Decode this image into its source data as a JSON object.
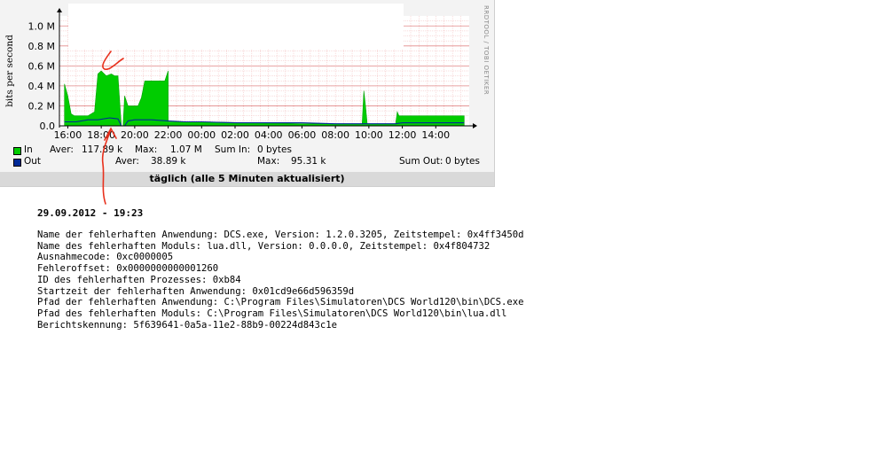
{
  "chart_data": {
    "type": "area",
    "ylabel": "bits per second",
    "y_ticks": [
      "1.0 M",
      "0.8 M",
      "0.6 M",
      "0.4 M",
      "0.2 M",
      "0.0"
    ],
    "ylim": [
      0,
      1.1
    ],
    "x_ticks": [
      "16:00",
      "18:00",
      "20:00",
      "22:00",
      "00:00",
      "02:00",
      "04:00",
      "06:00",
      "08:00",
      "10:00",
      "12:00",
      "14:00"
    ],
    "grid": true,
    "series": [
      {
        "name": "In",
        "color": "#00cc00",
        "x": [
          15.8,
          16.0,
          16.2,
          16.4,
          16.8,
          17.2,
          17.6,
          17.8,
          18.0,
          18.3,
          18.6,
          18.8,
          19.0,
          19.2,
          19.3,
          19.4,
          19.5,
          19.6,
          19.7,
          20.0,
          20.2,
          20.4,
          20.6,
          20.8,
          21.0,
          21.2,
          21.3,
          21.4,
          21.6,
          21.8,
          22.0,
          22.0,
          23.8,
          30.2,
          33.6,
          33.7,
          33.8,
          33.9,
          34.0,
          35.6,
          35.7,
          35.8,
          36.0,
          37.0,
          38.0,
          39.7
        ],
        "values": [
          0.42,
          0.3,
          0.12,
          0.1,
          0.1,
          0.1,
          0.14,
          0.52,
          0.55,
          0.5,
          0.52,
          0.5,
          0.5,
          0.0,
          0.0,
          0.3,
          0.25,
          0.2,
          0.2,
          0.2,
          0.2,
          0.28,
          0.45,
          0.45,
          0.45,
          0.45,
          0.45,
          0.45,
          0.45,
          0.45,
          0.55,
          0.04,
          0.04,
          0.02,
          0.02,
          0.35,
          0.2,
          0.02,
          0.02,
          0.02,
          0.14,
          0.1,
          0.1,
          0.1,
          0.1,
          0.1
        ]
      },
      {
        "name": "Out",
        "color": "#002a97",
        "x": [
          15.8,
          16.5,
          17.2,
          17.8,
          18.5,
          19.0,
          19.2,
          19.4,
          19.6,
          20.0,
          21.0,
          22.0,
          23.0,
          24.0,
          26.0,
          28.0,
          30.0,
          32.0,
          34.0,
          35.6,
          36.0,
          38.0,
          39.7
        ],
        "values": [
          0.04,
          0.04,
          0.06,
          0.06,
          0.08,
          0.07,
          0.0,
          0.0,
          0.05,
          0.06,
          0.06,
          0.05,
          0.04,
          0.04,
          0.03,
          0.03,
          0.03,
          0.02,
          0.02,
          0.02,
          0.03,
          0.03,
          0.03
        ]
      }
    ],
    "legend": [
      {
        "name": "In",
        "color": "#00cc00",
        "aver_label": "Aver:",
        "aver": "117.89 k",
        "max_label": "Max:",
        "max": "1.07 M",
        "sum_label": "Sum In:",
        "sum": "0 bytes"
      },
      {
        "name": "Out",
        "color": "#002a97",
        "aver_label": "Aver:",
        "aver": "38.89 k",
        "max_label": "Max:",
        "max": "95.31 k",
        "sum_label": "Sum Out:",
        "sum": "0 bytes"
      }
    ],
    "caption": "täglich (alle 5 Minuten aktualisiert)",
    "credit": "RRDTOOL / TOBI OETIKER"
  },
  "error_report": {
    "title": "29.09.2012 - 19:23",
    "lines": [
      "Name der fehlerhaften Anwendung: DCS.exe, Version: 1.2.0.3205, Zeitstempel: 0x4ff3450d",
      "Name des fehlerhaften Moduls: lua.dll, Version: 0.0.0.0, Zeitstempel: 0x4f804732",
      "Ausnahmecode: 0xc0000005",
      "Fehleroffset: 0x0000000000001260",
      "ID des fehlerhaften Prozesses: 0xb84",
      "Startzeit der fehlerhaften Anwendung: 0x01cd9e66d596359d",
      "Pfad der fehlerhaften Anwendung: C:\\Program Files\\Simulatoren\\DCS World120\\bin\\DCS.exe",
      "Pfad des fehlerhaften Moduls: C:\\Program Files\\Simulatoren\\DCS World120\\bin\\lua.dll",
      "Berichtskennung: 5f639641-0a5a-11e2-88b9-00224d843c1e"
    ]
  },
  "colors": {
    "panel_bg": "#f3f3f3",
    "plot_bg": "#ffffff",
    "grid": "#f2b8b8",
    "annotation": "#e8301c"
  }
}
